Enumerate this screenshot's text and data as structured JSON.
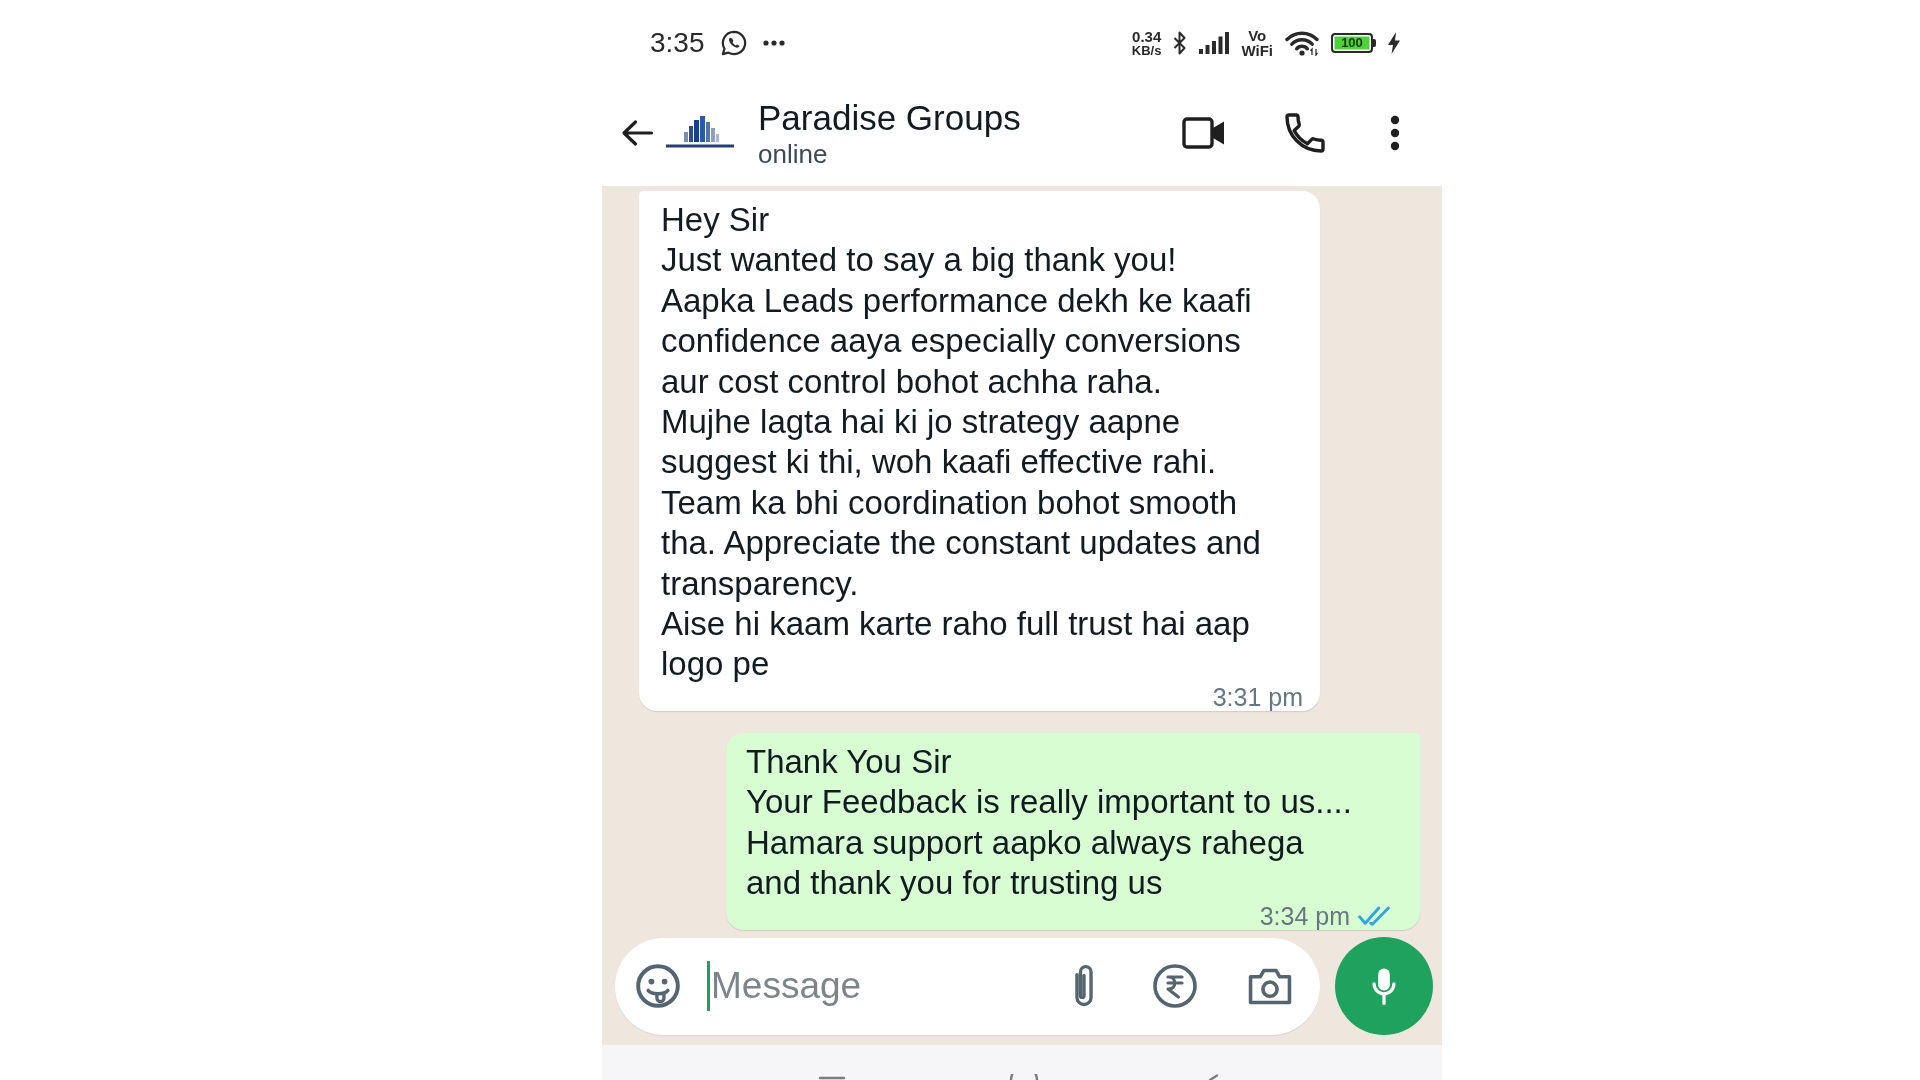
{
  "status_bar": {
    "time": "3:35",
    "network_speed": [
      "0.34",
      "KB/s"
    ],
    "vowifi": [
      "Vo",
      "WiFi"
    ],
    "battery": "100"
  },
  "chat_header": {
    "name": "Paradise Groups",
    "status": "online"
  },
  "messages": [
    {
      "kind": "incoming",
      "text": "Hey Sir\nJust wanted to say a big thank you!\nAapka Leads performance dekh ke kaafi\nconfidence aaya especially conversions\naur cost control bohot achha raha.\nMujhe lagta hai ki jo strategy aapne\nsuggest ki thi, woh kaafi effective rahi.\nTeam ka bhi coordination bohot smooth\ntha. Appreciate the constant updates and\ntransparency.\nAise hi kaam karte raho full trust hai aap\nlogo pe",
      "time": "3:31 pm"
    },
    {
      "kind": "outgoing",
      "text": "Thank You Sir\nYour Feedback is really important to us....\nHamara support aapko always rahega\nand thank you for trusting us",
      "time": "3:34 pm",
      "read": true
    }
  ],
  "composer": {
    "placeholder": "Message"
  }
}
